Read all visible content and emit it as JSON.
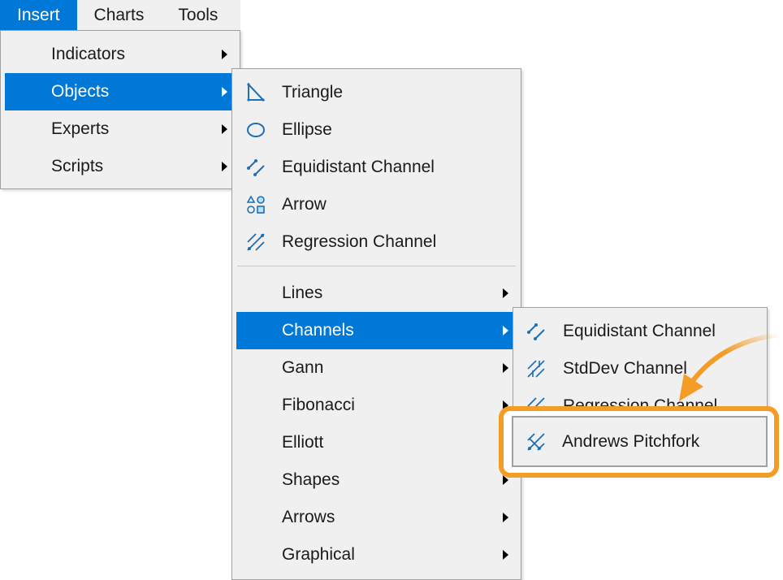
{
  "menubar": {
    "items": [
      {
        "label": "Insert",
        "active": true
      },
      {
        "label": "Charts"
      },
      {
        "label": "Tools"
      }
    ]
  },
  "insert_menu": {
    "items": [
      {
        "label": "Indicators",
        "submenu": true
      },
      {
        "label": "Objects",
        "submenu": true,
        "selected": true
      },
      {
        "label": "Experts",
        "submenu": true
      },
      {
        "label": "Scripts",
        "submenu": true
      }
    ]
  },
  "objects_menu": {
    "top_items": [
      {
        "label": "Triangle",
        "icon": "triangle-icon"
      },
      {
        "label": "Ellipse",
        "icon": "ellipse-icon"
      },
      {
        "label": "Equidistant Channel",
        "icon": "equidistant-channel-icon"
      },
      {
        "label": "Arrow",
        "icon": "shapes-icon"
      },
      {
        "label": "Regression Channel",
        "icon": "regression-channel-icon"
      }
    ],
    "sub_items": [
      {
        "label": "Lines"
      },
      {
        "label": "Channels",
        "selected": true
      },
      {
        "label": "Gann"
      },
      {
        "label": "Fibonacci"
      },
      {
        "label": "Elliott"
      },
      {
        "label": "Shapes"
      },
      {
        "label": "Arrows"
      },
      {
        "label": "Graphical"
      }
    ]
  },
  "channels_menu": {
    "items": [
      {
        "label": "Equidistant Channel",
        "icon": "equidistant-channel-icon"
      },
      {
        "label": "StdDev Channel",
        "icon": "stddev-channel-icon"
      },
      {
        "label": "Regression Channel",
        "icon": "regression-channel-icon"
      },
      {
        "label": "Andrews Pitchfork",
        "icon": "andrews-pitchfork-icon",
        "highlighted": true
      }
    ]
  },
  "colors": {
    "accent": "#0078d7",
    "highlight": "#f39c26",
    "icon": "#1e6fb5"
  }
}
